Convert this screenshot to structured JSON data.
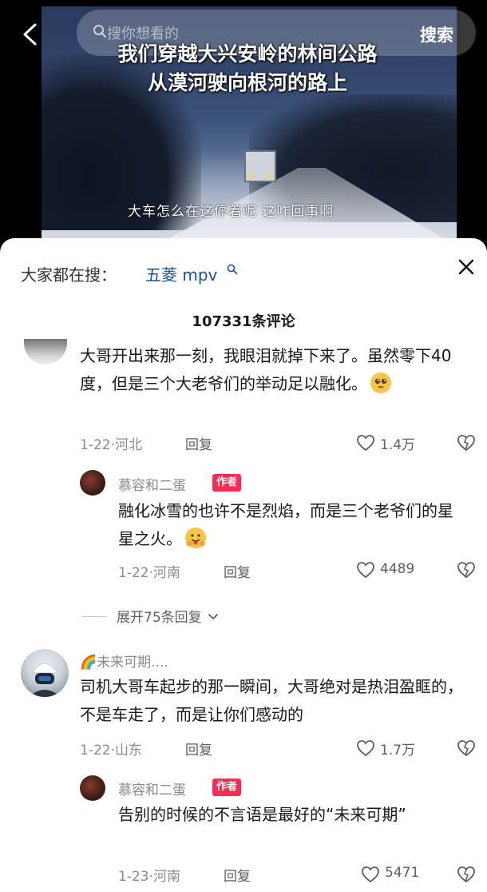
{
  "header": {
    "search_placeholder": "搜你想看的",
    "search_button": "搜索",
    "caption_line1": "我们穿越大兴安岭的林间公路",
    "caption_line2": "从漠河驶向根河的路上",
    "subtitle": "大车怎么在这停着呢 这咋回事啊"
  },
  "sheet": {
    "everyone_search_label": "大家都在搜：",
    "search_term": "五菱 mpv",
    "comment_count": "107331条评论"
  },
  "comments": [
    {
      "text": "大哥开出来那一刻，我眼泪就掉下来了。虽然零下40度，但是三个大老爷们的举动足以融化。",
      "emoji": "pleading-face",
      "date_location": "1-22·河北",
      "reply_label": "回复",
      "likes": "1.4万",
      "reply": {
        "name": "慕容和二蛋",
        "badge": "作者",
        "text": "融化冰雪的也许不是烈焰，而是三个老爷们的星星之火。",
        "emoji": "hugging-face",
        "date_location": "1-22·河南",
        "reply_label": "回复",
        "likes": "4489"
      },
      "expand_label": "展开75条回复"
    },
    {
      "name": "🌈未来可期....",
      "text": "司机大哥车起步的那一瞬间，大哥绝对是热泪盈眶的，不是车走了，而是让你们感动的",
      "date_location": "1-22·山东",
      "reply_label": "回复",
      "likes": "1.7万",
      "reply": {
        "name": "慕容和二蛋",
        "badge": "作者",
        "text": "告别的时候的不言语是最好的“未来可期”",
        "date_location": "1-23·河南",
        "reply_label": "回复",
        "likes": "5471"
      }
    }
  ],
  "colors": {
    "author_badge": "#fe2c55",
    "search_term": "#1a4fa3",
    "meta_gray": "#8a8b91"
  }
}
